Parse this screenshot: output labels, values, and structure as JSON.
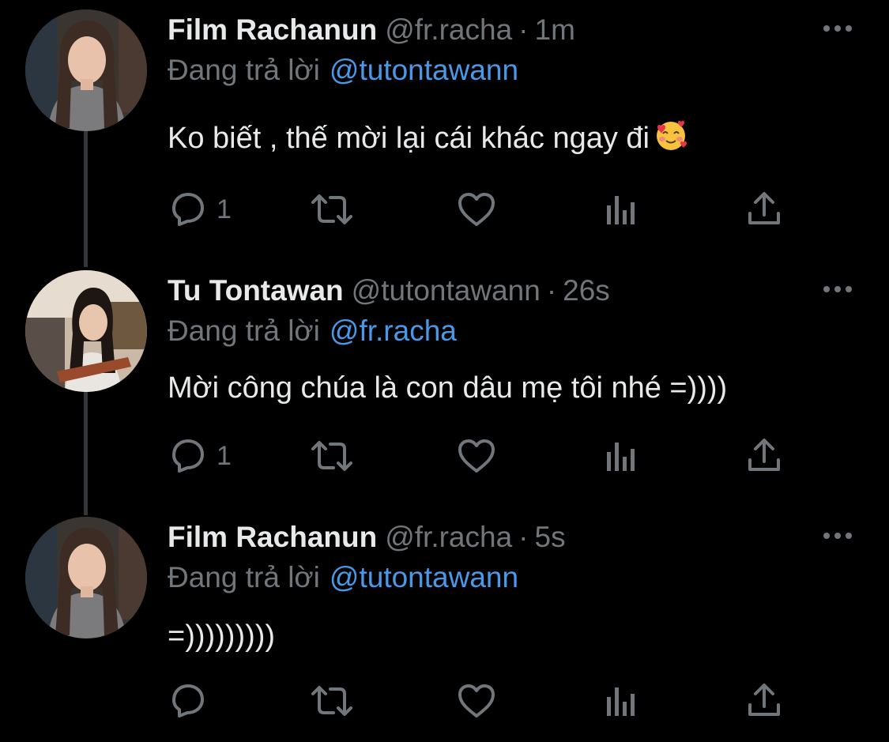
{
  "tweets": [
    {
      "name": "Film Rachanun",
      "handle": "@fr.racha",
      "separator": "·",
      "time": "1m",
      "reply_prefix": "Đang trả lời",
      "reply_to": "@tutontawann",
      "text": "Ko biết , thế mời lại cái khác ngay đi",
      "emoji": "smiling-face-with-hearts-emoji",
      "reply_count": "1",
      "avatar": "film-rachanun-avatar"
    },
    {
      "name": "Tu Tontawan",
      "handle": "@tutontawann",
      "separator": "·",
      "time": "26s",
      "reply_prefix": "Đang trả lời",
      "reply_to": "@fr.racha",
      "text": "Mời công chúa là con dâu mẹ tôi nhé =))))",
      "reply_count": "1",
      "avatar": "tu-tontawan-avatar"
    },
    {
      "name": "Film Rachanun",
      "handle": "@fr.racha",
      "separator": "·",
      "time": "5s",
      "reply_prefix": "Đang trả lời",
      "reply_to": "@tutontawann",
      "text": "=)))))))))",
      "reply_count": "",
      "avatar": "film-rachanun-avatar"
    }
  ],
  "icons": [
    "reply-icon",
    "retweet-icon",
    "like-icon",
    "views-icon",
    "share-icon",
    "more-icon"
  ],
  "colors": {
    "background": "#000000",
    "text": "#e7e9ea",
    "muted": "#71767b",
    "mention": "#4a99e9",
    "thread_line": "#333639"
  }
}
